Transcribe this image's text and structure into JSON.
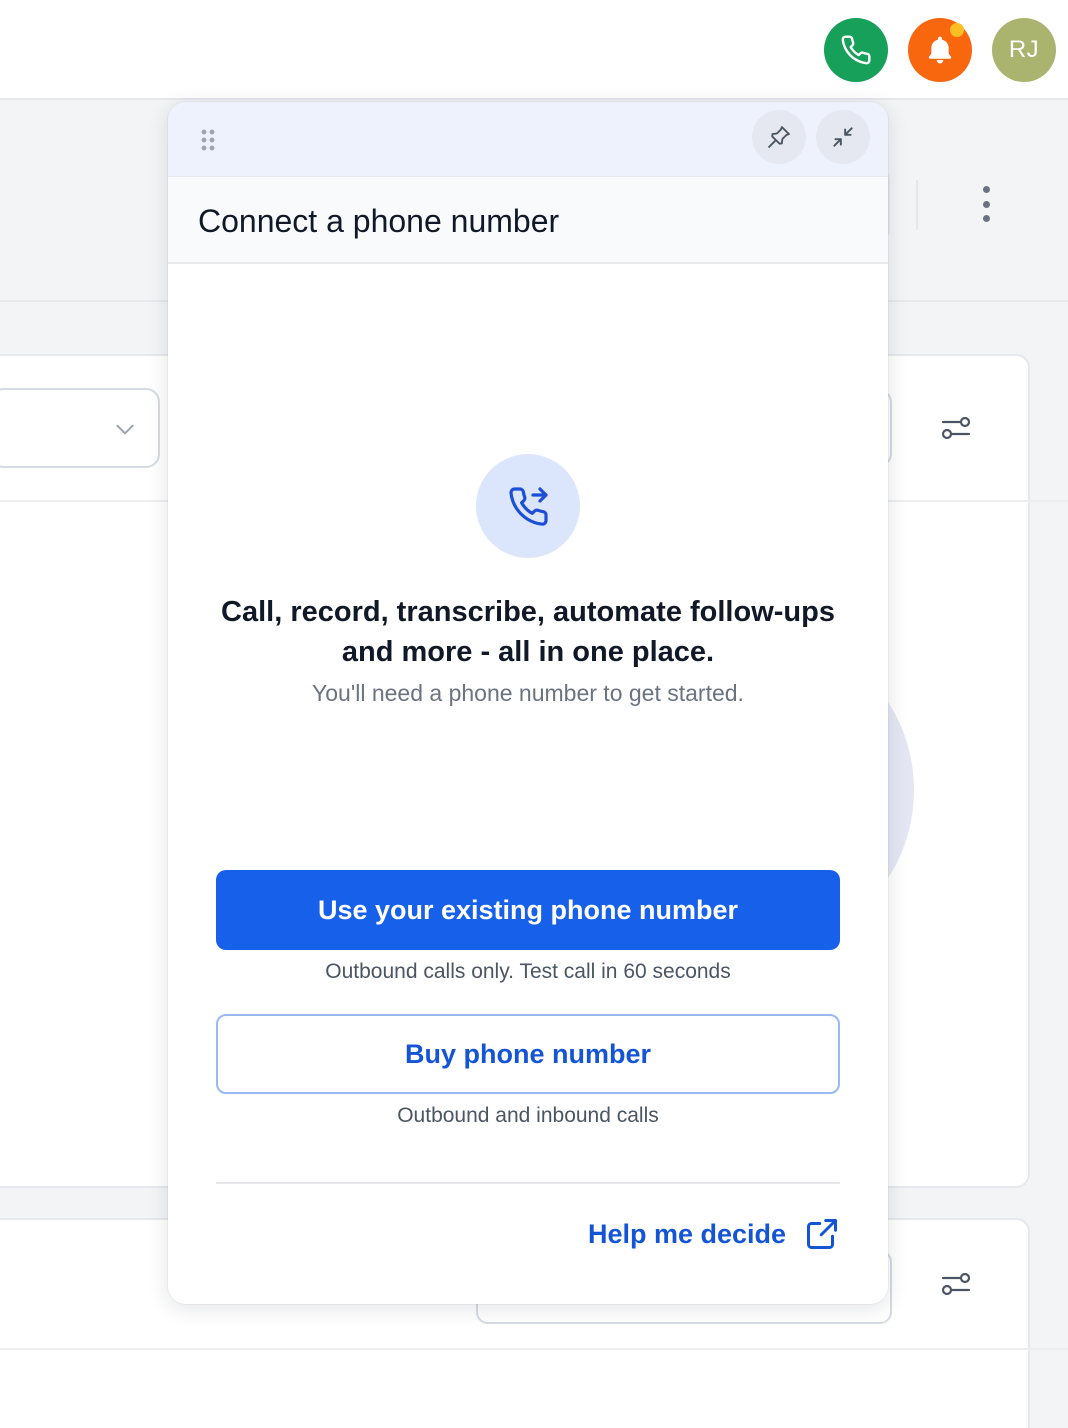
{
  "header": {
    "call_icon": "phone-icon",
    "notification_icon": "bell-icon",
    "avatar_initials": "RJ",
    "colors": {
      "call": "#16a05a",
      "notifications": "#f8660e",
      "avatar": "#aab46f"
    }
  },
  "modal": {
    "title": "Connect a phone number",
    "toolbar": {
      "pin_icon": "pin-icon",
      "minimize_icon": "minimize-icon",
      "drag_icon": "drag-handle-icon"
    },
    "hero_icon": "phone-forward-icon",
    "headline_line1": "Call, record, transcribe, automate follow-ups",
    "headline_line2": "and more - all in one place.",
    "subtitle": "You'll need a phone number to get started.",
    "primary_button": "Use your existing phone number",
    "primary_note": "Outbound calls only. Test call in 60 seconds",
    "secondary_button": "Buy phone number",
    "secondary_note": "Outbound and inbound calls",
    "help_link": "Help me decide",
    "colors": {
      "primary": "#1761ea",
      "link": "#1455d6"
    }
  }
}
